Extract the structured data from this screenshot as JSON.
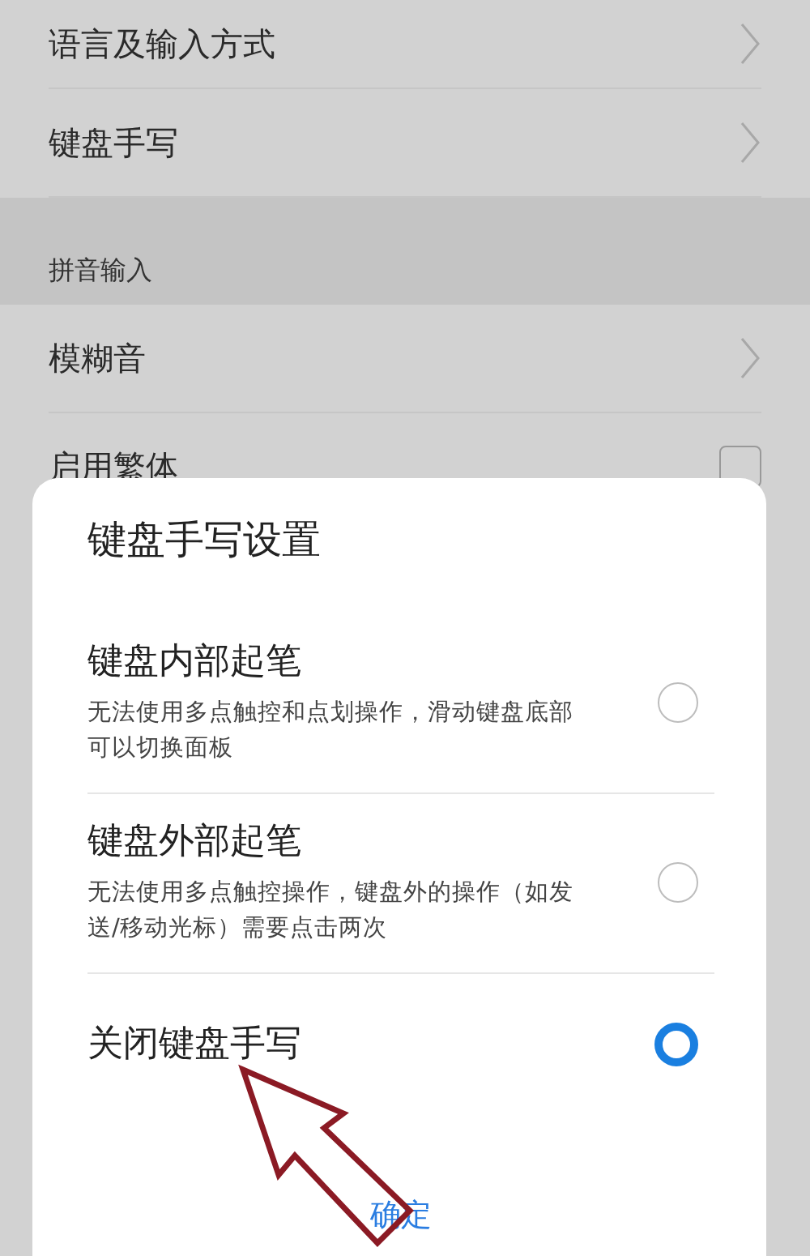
{
  "settings_list": [
    {
      "kind": "link",
      "label": "语言及输入方式"
    },
    {
      "kind": "link",
      "label": "键盘手写"
    },
    {
      "kind": "header",
      "label": "拼音输入"
    },
    {
      "kind": "link",
      "label": "模糊音"
    },
    {
      "kind": "checkbox",
      "label": "启用繁体",
      "checked": false
    }
  ],
  "dialog": {
    "title": "键盘手写设置",
    "options": [
      {
        "title": "键盘内部起笔",
        "description": "无法使用多点触控和点划操作，滑动键盘底部可以切换面板",
        "selected": false
      },
      {
        "title": "键盘外部起笔",
        "description": "无法使用多点触控操作，键盘外的操作（如发送/移动光标）需要点击两次",
        "selected": false
      },
      {
        "title": "关闭键盘手写",
        "selected": true
      }
    ],
    "confirm_button": "确定"
  }
}
